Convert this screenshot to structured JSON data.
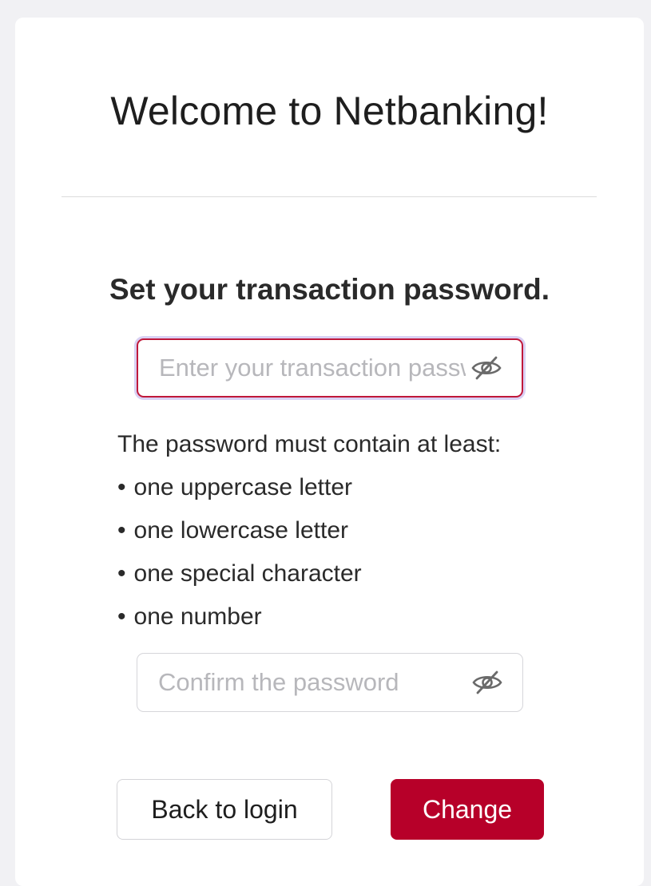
{
  "header": {
    "title": "Welcome to Netbanking!"
  },
  "form": {
    "heading_prefix": "Set your ",
    "heading_bold": "transaction password",
    "heading_suffix": ".",
    "password_placeholder": "Enter your transaction password",
    "password_toggle_icon": "eye-slash-icon",
    "confirm_placeholder": "Confirm the password",
    "confirm_toggle_icon": "eye-slash-icon",
    "rules_intro": "The password must contain at least:",
    "rules": [
      "one uppercase letter",
      "one lowercase letter",
      "one special character",
      "one number"
    ]
  },
  "actions": {
    "back_label": "Back to login",
    "change_label": "Change"
  },
  "colors": {
    "accent": "#b70029",
    "focus_ring": "#d9d0f3",
    "page_background": "#f1f1f4",
    "card_background": "#ffffff"
  }
}
